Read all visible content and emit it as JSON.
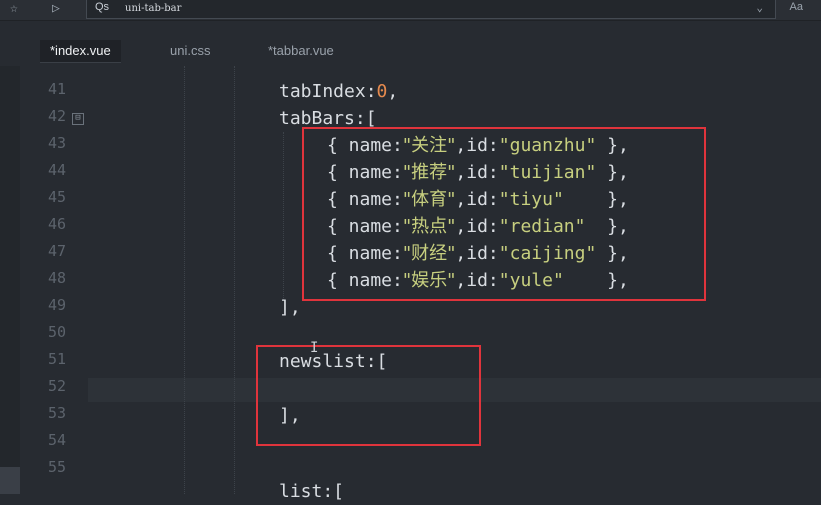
{
  "toolbar": {
    "star_icon": "☆",
    "play_icon": "▷",
    "search_prefix": "Qs",
    "search_value": "uni-tab-bar",
    "chevron_icon": "⌄",
    "aa_label": "Aa"
  },
  "tabs": [
    {
      "label": "*index.vue"
    },
    {
      "label": "uni.css"
    },
    {
      "label": "*tabbar.vue"
    }
  ],
  "line_numbers": [
    "41",
    "42",
    "43",
    "44",
    "45",
    "46",
    "47",
    "48",
    "49",
    "50",
    "51",
    "52",
    "53",
    "54",
    "55"
  ],
  "fold_marker": "⊟",
  "code": {
    "l41": {
      "key": "tabIndex:",
      "num": "0",
      "end": ","
    },
    "l42": {
      "text": "tabBars:["
    },
    "items": [
      {
        "open": "{ name:",
        "name": "\"关注\"",
        "mid": ",id:",
        "id": "\"guanzhu\"",
        "close": " },"
      },
      {
        "open": "{ name:",
        "name": "\"推荐\"",
        "mid": ",id:",
        "id": "\"tuijian\"",
        "close": " },"
      },
      {
        "open": "{ name:",
        "name": "\"体育\"",
        "mid": ",id:",
        "id": "\"tiyu\"",
        "close": "    },"
      },
      {
        "open": "{ name:",
        "name": "\"热点\"",
        "mid": ",id:",
        "id": "\"redian\"",
        "close": "  },"
      },
      {
        "open": "{ name:",
        "name": "\"财经\"",
        "mid": ",id:",
        "id": "\"caijing\"",
        "close": " },"
      },
      {
        "open": "{ name:",
        "name": "\"娱乐\"",
        "mid": ",id:",
        "id": "\"yule\"",
        "close": "    },"
      }
    ],
    "l49": "],",
    "l51": "newslist:[",
    "l53": "],",
    "l56": "list:["
  },
  "colors": {
    "highlight_box": "#e0343c",
    "string": "#c7cf7f",
    "number": "#e58a4e"
  }
}
